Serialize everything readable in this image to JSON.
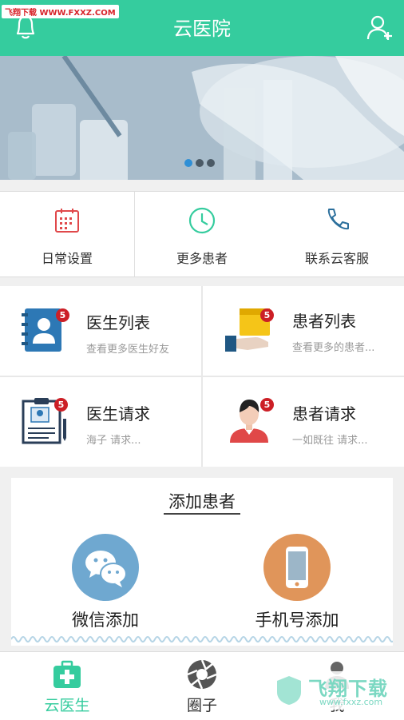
{
  "header": {
    "title": "云医院",
    "left_icon": "bell-icon",
    "right_icon": "add-user-icon"
  },
  "watermark_top": "飞翔下载 WWW.FXXZ.COM",
  "banner": {
    "pages": 3,
    "active_page": 1
  },
  "quick_actions": [
    {
      "label": "日常设置",
      "icon": "calendar-icon",
      "color": "#e0484a"
    },
    {
      "label": "更多患者",
      "icon": "clock-icon",
      "color": "#35cc9e"
    },
    {
      "label": "联系云客服",
      "icon": "phone-icon",
      "color": "#2b6f9c"
    }
  ],
  "grid": [
    {
      "title": "医生列表",
      "subtitle": "查看更多医生好友",
      "badge": "5",
      "icon": "contacts-book-icon"
    },
    {
      "title": "患者列表",
      "subtitle": "查看更多的患者...",
      "badge": "5",
      "icon": "folder-hand-icon"
    },
    {
      "title": "医生请求",
      "subtitle": "海子  请求...",
      "badge": "5",
      "icon": "id-clipboard-icon"
    },
    {
      "title": "患者请求",
      "subtitle": "一如既往  请求...",
      "badge": "5",
      "icon": "patient-avatar-icon"
    }
  ],
  "add_patient": {
    "title": "添加患者",
    "wechat_label": "微信添加",
    "phone_label": "手机号添加"
  },
  "tabs": [
    {
      "label": "云医生",
      "icon": "medical-kit-icon",
      "active": true
    },
    {
      "label": "圈子",
      "icon": "aperture-icon",
      "active": false
    },
    {
      "label": "我",
      "icon": "person-icon",
      "active": false
    }
  ],
  "watermark_bottom": {
    "big": "飞翔下载",
    "small": "www.fxxz.com"
  },
  "colors": {
    "accent": "#35cc9e",
    "badge": "#cc1f26"
  }
}
